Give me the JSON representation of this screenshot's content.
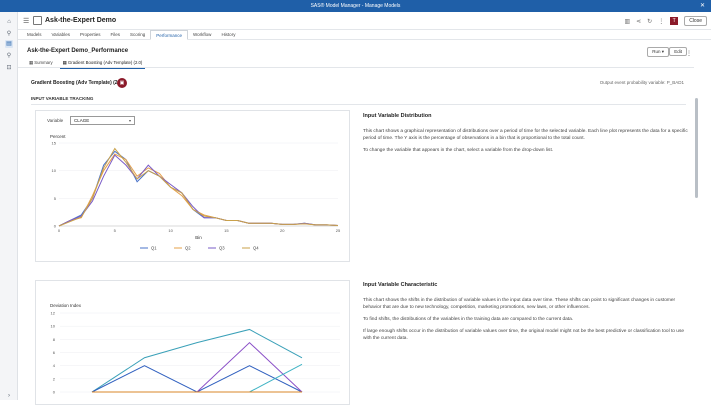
{
  "window": {
    "title": "SAS® Model Manager - Manage Models",
    "close_icon": "close-icon"
  },
  "header": {
    "project_title": "Ask-the-Expert Demo",
    "close_label": "Close",
    "user_initials": "T"
  },
  "tabs": [
    "Models",
    "Variables",
    "Properties",
    "Files",
    "Scoring",
    "Performance",
    "Workflow",
    "History"
  ],
  "active_tab": "Performance",
  "performance": {
    "title": "Ask-the-Expert Demo_Performance",
    "run_label": "Run",
    "edit_label": "Edit",
    "subtabs": [
      "Summary",
      "Gradient Boosting (Adv Template) (2.0)"
    ],
    "model_name": "Gradient Boosting (Adv Template) (2.0)",
    "output_text": "Output event probability variable: P_BAD1",
    "section_title": "INPUT VARIABLE TRACKING",
    "variable_label": "Variable",
    "variable_value": "CLAGE"
  },
  "distribution_info": {
    "heading": "Input Variable Distribution",
    "p1": "This chart shows a graphical representation of distributions over a period of time for the selected variable. Each line plot represents the data for a specific period of time. The Y axis is the percentage of observations in a bin that is proportional to the total count.",
    "p2": "To change the variable that appears in the chart, select a variable from the drop-down list."
  },
  "characteristic_info": {
    "heading": "Input Variable Characteristic",
    "p1": "This chart shows the shifts in the distribution of variable values in the input data over time. These shifts can point to significant changes in customer behavior that are due to new technology, competition, marketing promotions, new laws, or other influences.",
    "p2": "To find shifts, the distributions of the variables in the training data are compared to the current data.",
    "p3": "If large enough shifts occur in the distribution of variable values over time, the original model might not be the best predictive or classification tool to use with the current data."
  },
  "chart_data": [
    {
      "type": "line",
      "ylabel": "Percent",
      "xlabel": "Bin",
      "xlim": [
        0,
        25
      ],
      "ylim": [
        0,
        15
      ],
      "xticks": [
        0,
        5,
        10,
        15,
        20,
        25
      ],
      "yticks": [
        0,
        5,
        10,
        15
      ],
      "x": [
        0,
        1,
        2,
        3,
        4,
        5,
        6,
        7,
        8,
        9,
        10,
        11,
        12,
        13,
        14,
        15,
        16,
        17,
        18,
        19,
        20,
        21,
        22,
        23,
        24,
        25
      ],
      "series": [
        {
          "name": "Q1",
          "color": "#4a73c9",
          "values": [
            0,
            1,
            2,
            5,
            11,
            13.5,
            12,
            8,
            10,
            9,
            7,
            6,
            3,
            1.5,
            1.5,
            1,
            1,
            0.5,
            0.5,
            0.5,
            0.3,
            0.3,
            0.5,
            0.2,
            0.2,
            0.1
          ]
        },
        {
          "name": "Q2",
          "color": "#e6a04a",
          "values": [
            0,
            1,
            1.5,
            5.5,
            10,
            13,
            12,
            9,
            10.5,
            9.5,
            7,
            5.5,
            3,
            2,
            1.5,
            1,
            1,
            0.5,
            0.5,
            0.5,
            0.3,
            0.3,
            0.4,
            0.2,
            0.2,
            0.1
          ]
        },
        {
          "name": "Q3",
          "color": "#7a5cc7",
          "values": [
            0,
            1,
            1.8,
            4.5,
            9,
            12.8,
            11,
            8.5,
            11,
            9,
            7.5,
            6,
            3.5,
            1.5,
            1.5,
            1,
            1,
            0.5,
            0.5,
            0.5,
            0.3,
            0.3,
            0.5,
            0.2,
            0.2,
            0.1
          ]
        },
        {
          "name": "Q4",
          "color": "#c9a14a",
          "values": [
            0,
            0.8,
            1.6,
            5,
            10.5,
            14,
            11.5,
            8.5,
            10,
            9,
            7,
            6,
            3,
            1.8,
            1.5,
            1,
            1,
            0.5,
            0.5,
            0.5,
            0.3,
            0.3,
            0.4,
            0.2,
            0.2,
            0.1
          ]
        }
      ]
    },
    {
      "type": "line",
      "title": "Deviation Index",
      "ylim": [
        0,
        12
      ],
      "yticks": [
        0,
        2,
        4,
        6,
        8,
        10,
        12
      ],
      "x": [
        0,
        1,
        2,
        3,
        4
      ],
      "series": [
        {
          "color": "#3aa0b8",
          "values": [
            0,
            5.2,
            7.5,
            9.5,
            5.2
          ]
        },
        {
          "color": "#2f5fbf",
          "values": [
            0,
            4,
            0,
            4,
            0
          ]
        },
        {
          "color": "#8a4fc7",
          "values": [
            0,
            0,
            0,
            7.5,
            0
          ]
        },
        {
          "color": "#3fb3c4",
          "values": [
            0,
            0,
            0,
            0,
            4.2
          ]
        },
        {
          "color": "#d9872a",
          "values": [
            0,
            0,
            0,
            0,
            0
          ]
        }
      ]
    }
  ]
}
